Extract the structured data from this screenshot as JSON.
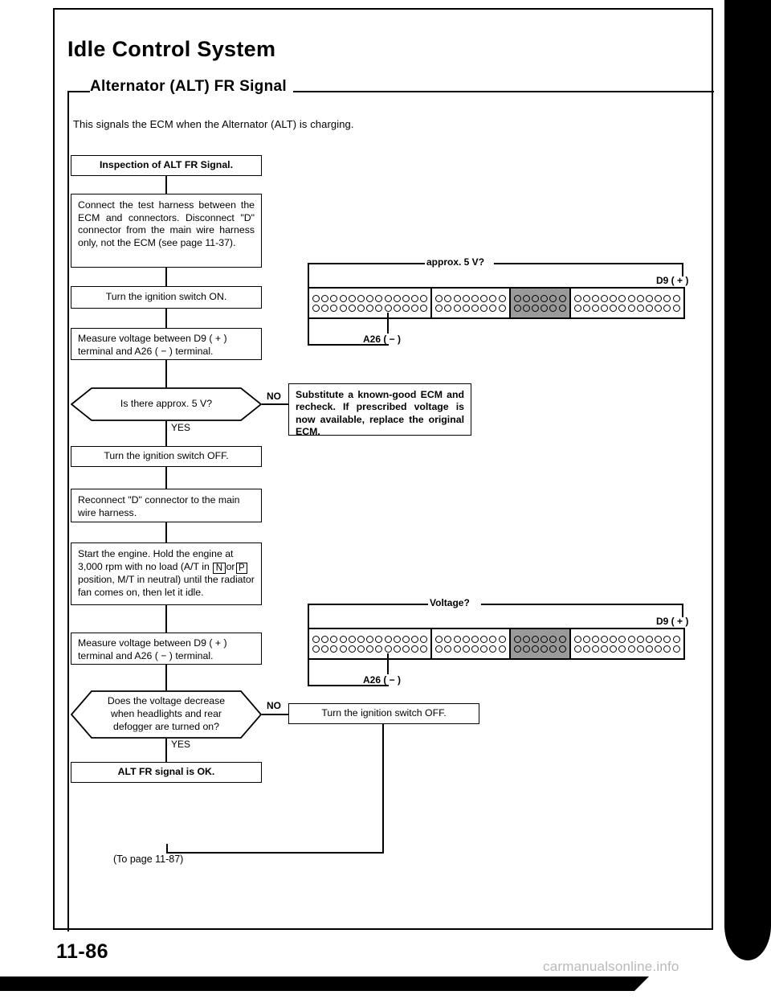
{
  "document": {
    "title": "Idle Control System",
    "section_title": "Alternator (ALT) FR Signal",
    "intro": "This signals the ECM when the Alternator (ALT) is charging.",
    "page_number": "11-86",
    "to_page": "(To page 11-87)",
    "watermark": "carmanualsonline.info"
  },
  "flow": {
    "step_inspection": "Inspection of ALT FR Signal.",
    "step_connect_harness": "Connect the test harness between the ECM and connectors. Disconnect \"D\" connector from the main wire harness only, not the ECM (see page 11-37).",
    "step_ignition_on": "Turn the ignition switch ON.",
    "step_measure_1": "Measure voltage between D9 ( + ) terminal and A26 ( − ) terminal.",
    "decision_1": "Is there approx. 5 V?",
    "decision_1_no": "NO",
    "decision_1_yes": "YES",
    "step_substitute_ecm": "Substitute a known-good ECM and recheck. If prescribed voltage is now available, replace the original ECM.",
    "step_ignition_off_1": "Turn the ignition switch OFF.",
    "step_reconnect": "Reconnect \"D\" connector to the main wire harness.",
    "step_start_engine_a": "Start the engine. Hold the engine at 3,000 rpm with no load (A/T in",
    "step_start_engine_gear_1": "N",
    "step_start_engine_or": "or",
    "step_start_engine_gear_2": "P",
    "step_start_engine_b": "position, M/T in neutral) until the radiator fan comes on, then let it idle.",
    "step_measure_2": "Measure voltage between D9 ( + ) terminal and A26 ( − ) terminal.",
    "decision_2": "Does the voltage decrease when headlights and rear defogger are turned on?",
    "decision_2_no": "NO",
    "decision_2_yes": "YES",
    "step_ignition_off_2": "Turn the ignition switch OFF.",
    "step_result_ok": "ALT FR signal is OK."
  },
  "connector_top": {
    "measurement_label": "approx. 5 V?",
    "pin_positive": "D9 ( + )",
    "pin_negative": "A26 ( − )",
    "banks": [
      {
        "pins_per_row": 13,
        "shaded": false
      },
      {
        "pins_per_row": 8,
        "shaded": false
      },
      {
        "pins_per_row": 6,
        "shaded": true
      },
      {
        "pins_per_row": 12,
        "shaded": false
      }
    ],
    "rows": 2
  },
  "connector_bottom": {
    "measurement_label": "Voltage?",
    "pin_positive": "D9 ( + )",
    "pin_negative": "A26 ( − )",
    "banks": [
      {
        "pins_per_row": 13,
        "shaded": false
      },
      {
        "pins_per_row": 8,
        "shaded": false
      },
      {
        "pins_per_row": 6,
        "shaded": true
      },
      {
        "pins_per_row": 12,
        "shaded": false
      }
    ],
    "rows": 2
  }
}
